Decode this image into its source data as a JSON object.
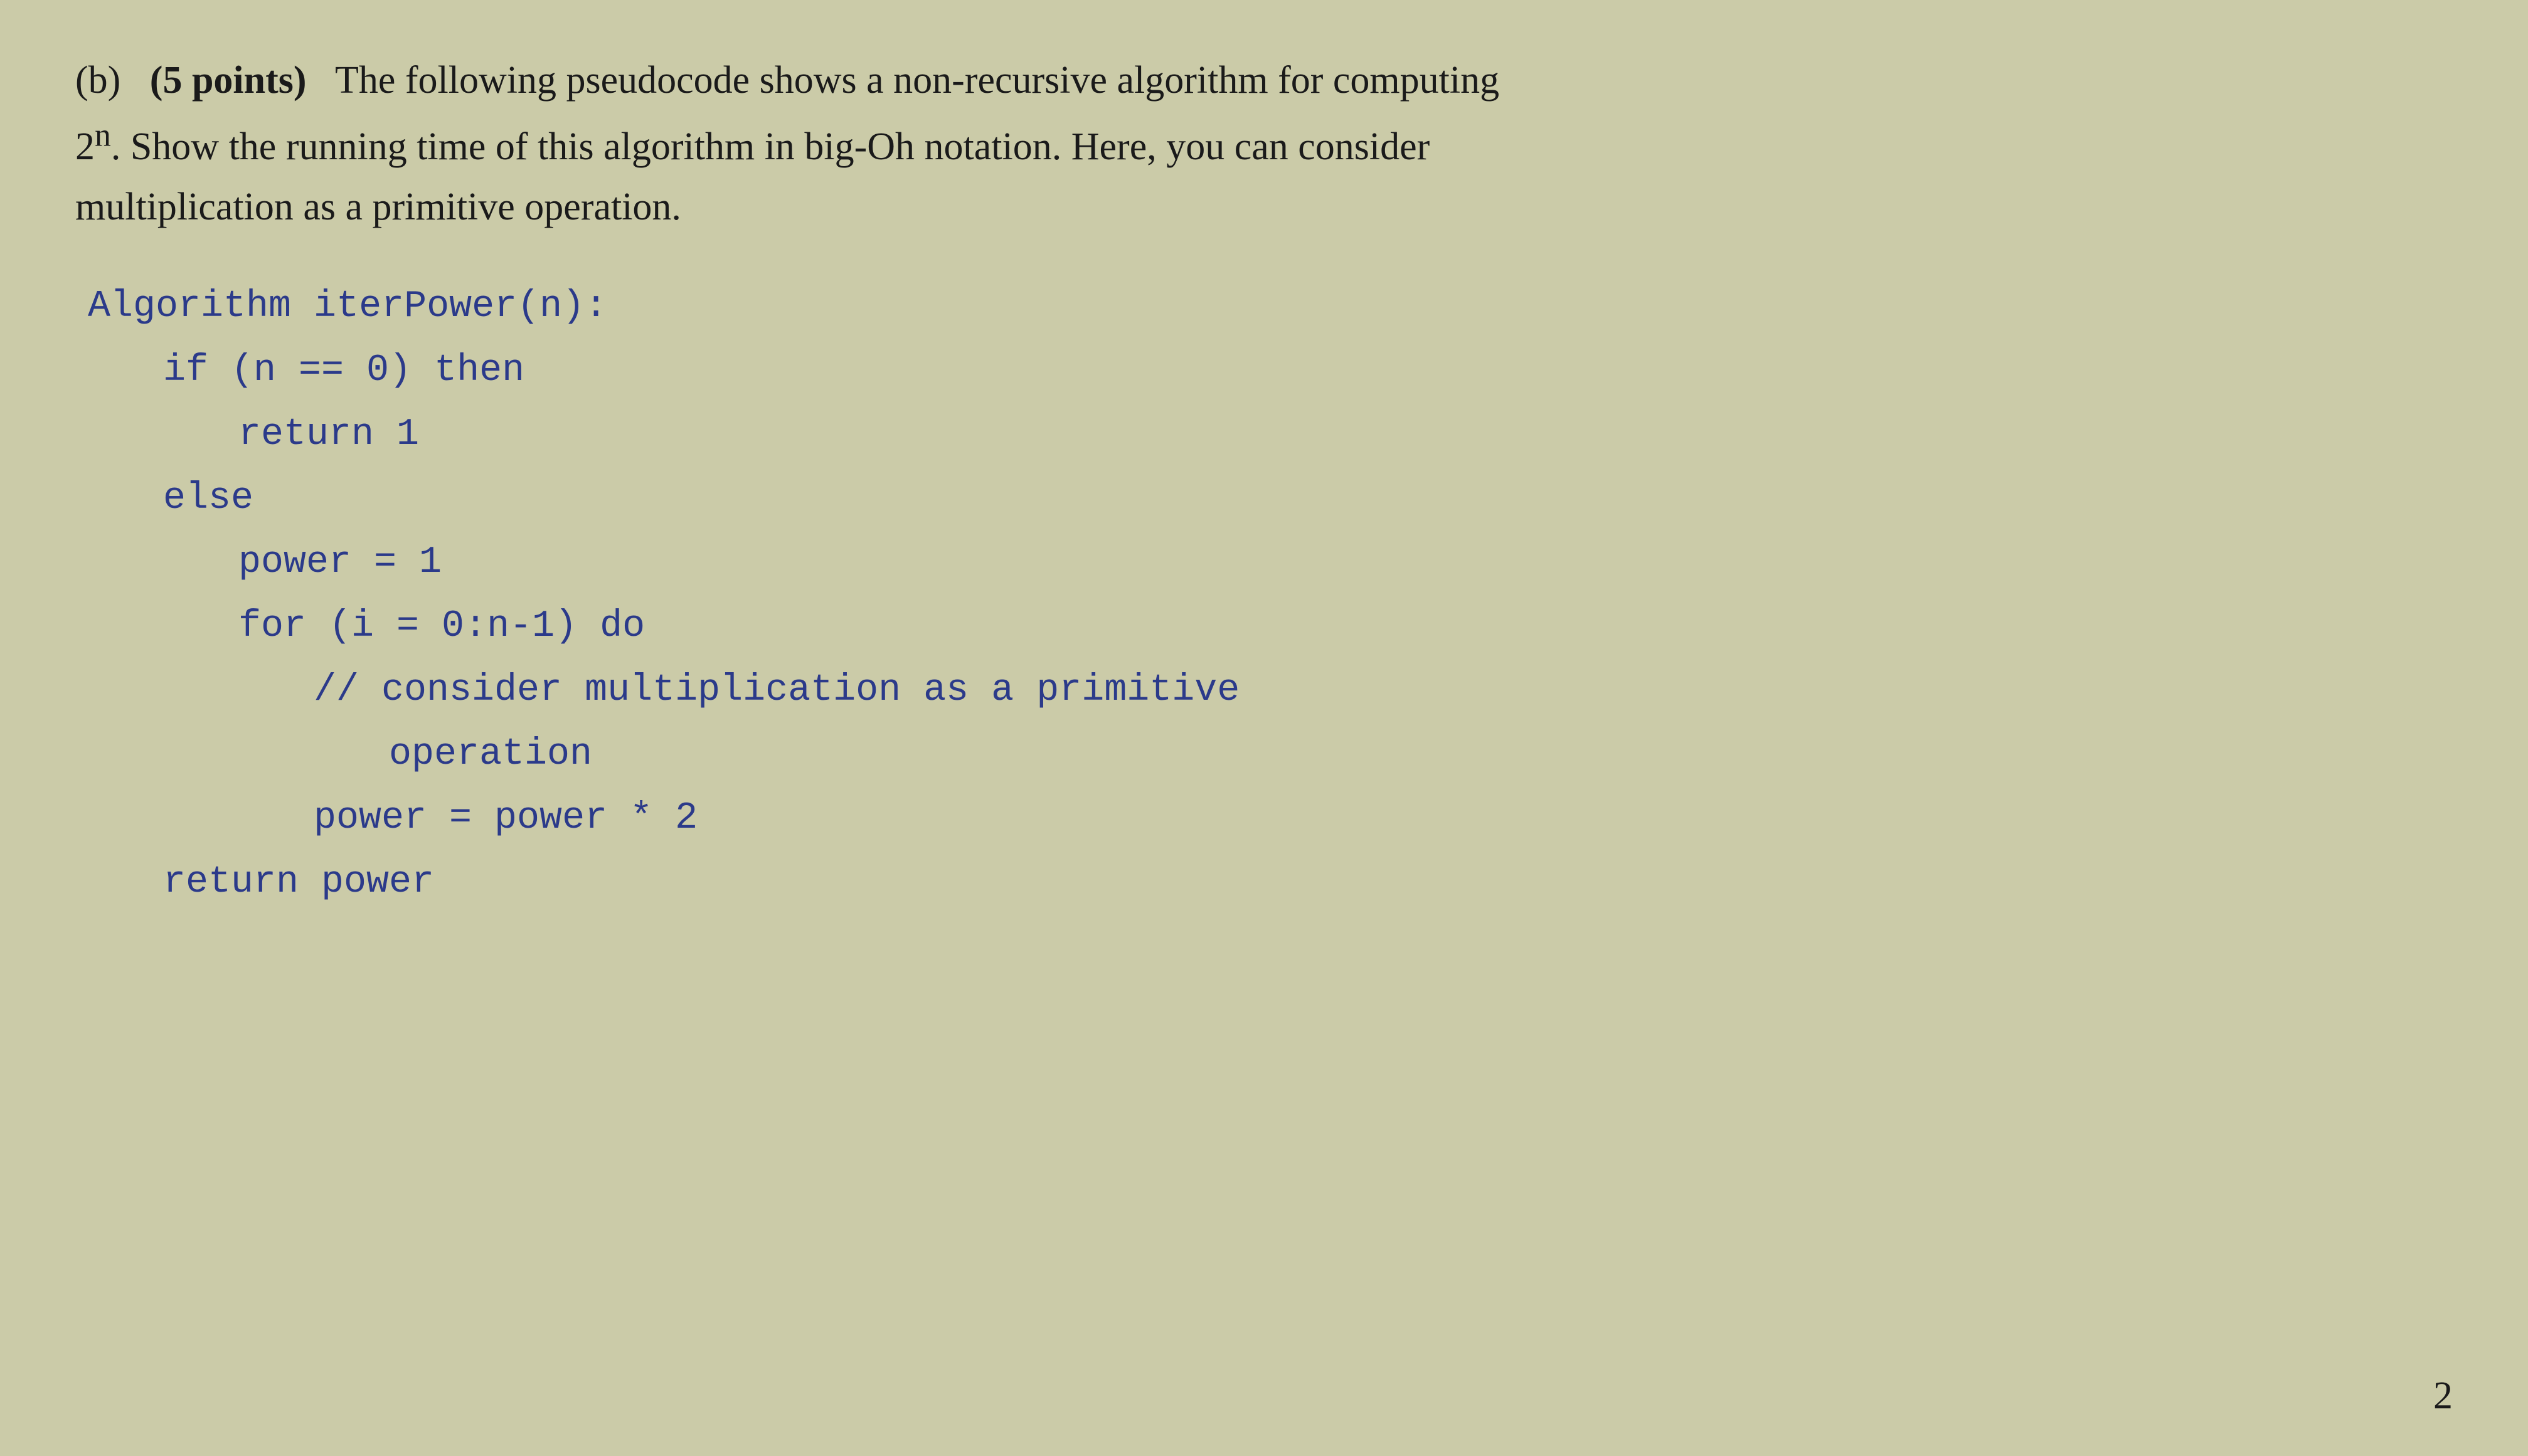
{
  "page": {
    "background_color": "#cbcba8",
    "page_number": "2"
  },
  "question": {
    "label": "(b)",
    "points": "(5 points)",
    "description_line1": "The following pseudocode shows a non-recursive algorithm for computing",
    "description_line2": "2ⁿ. Show the running time of this algorithm in big-Oh notation. Here, you can consider",
    "description_line3": "multiplication as a primitive operation."
  },
  "code": {
    "algorithm_header": "Algorithm iterPower(n):",
    "line1": "    if (n == 0) then",
    "line2": "        return 1",
    "line3": "    else",
    "line4": "        power = 1",
    "line5": "        for (i = 0:n-1) do",
    "line6": "            // consider multiplication as a primitive",
    "line7": "                operation",
    "line8": "            power = power * 2",
    "line9": "    return power"
  }
}
